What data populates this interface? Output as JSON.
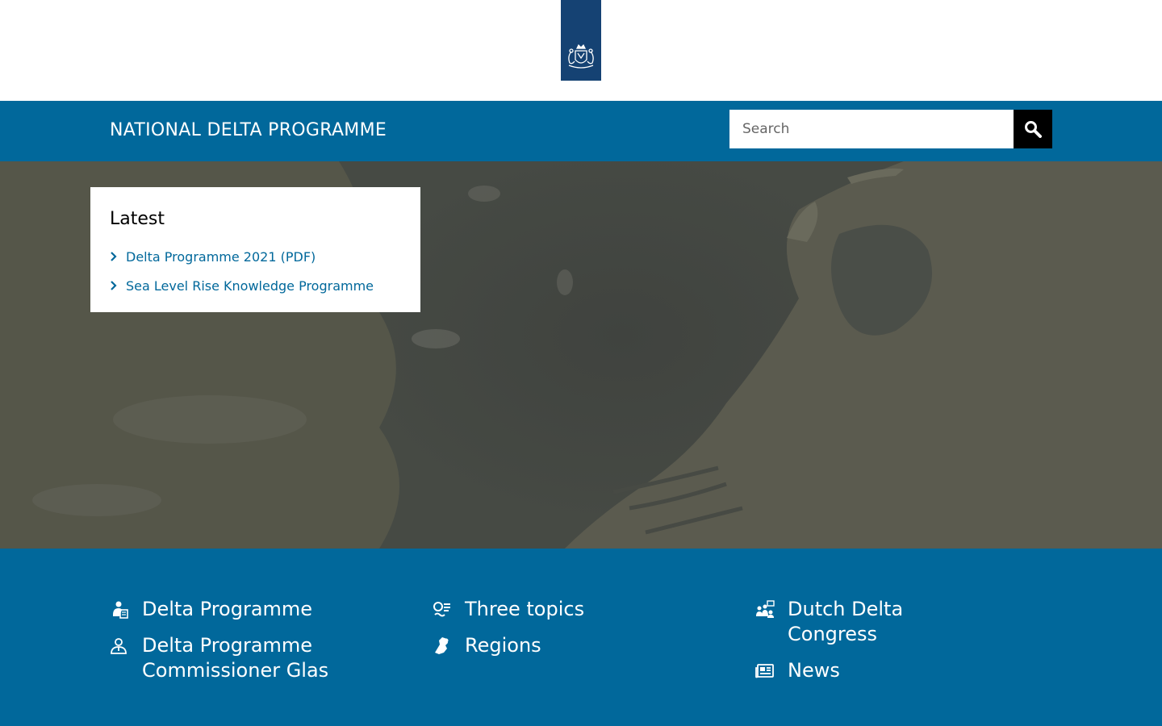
{
  "logo": {
    "name": "Rijksoverheid coat of arms",
    "icon": "coat-of-arms-icon",
    "color": "#154273"
  },
  "header": {
    "title": "NATIONAL DELTA PROGRAMME",
    "background": "#01689b",
    "search": {
      "placeholder": "Search",
      "value": "",
      "button_icon": "search-icon"
    }
  },
  "hero": {
    "latest": {
      "title": "Latest",
      "items": [
        {
          "label": "Delta Programme 2021 (PDF)",
          "icon": "chevron-right-icon"
        },
        {
          "label": "Sea Level Rise Knowledge Programme",
          "icon": "chevron-right-icon"
        }
      ]
    }
  },
  "bottom_nav": {
    "columns": [
      {
        "items": [
          {
            "label": "Delta Programme",
            "icon": "person-document-icon"
          },
          {
            "label": "Delta Programme Commissioner Glas",
            "icon": "person-icon"
          }
        ]
      },
      {
        "items": [
          {
            "label": "Three topics",
            "icon": "waves-icon"
          },
          {
            "label": "Regions",
            "icon": "netherlands-map-icon"
          }
        ]
      },
      {
        "items": [
          {
            "label": "Dutch Delta Congress",
            "icon": "people-group-icon"
          },
          {
            "label": "News",
            "icon": "newspaper-icon"
          }
        ]
      }
    ]
  }
}
